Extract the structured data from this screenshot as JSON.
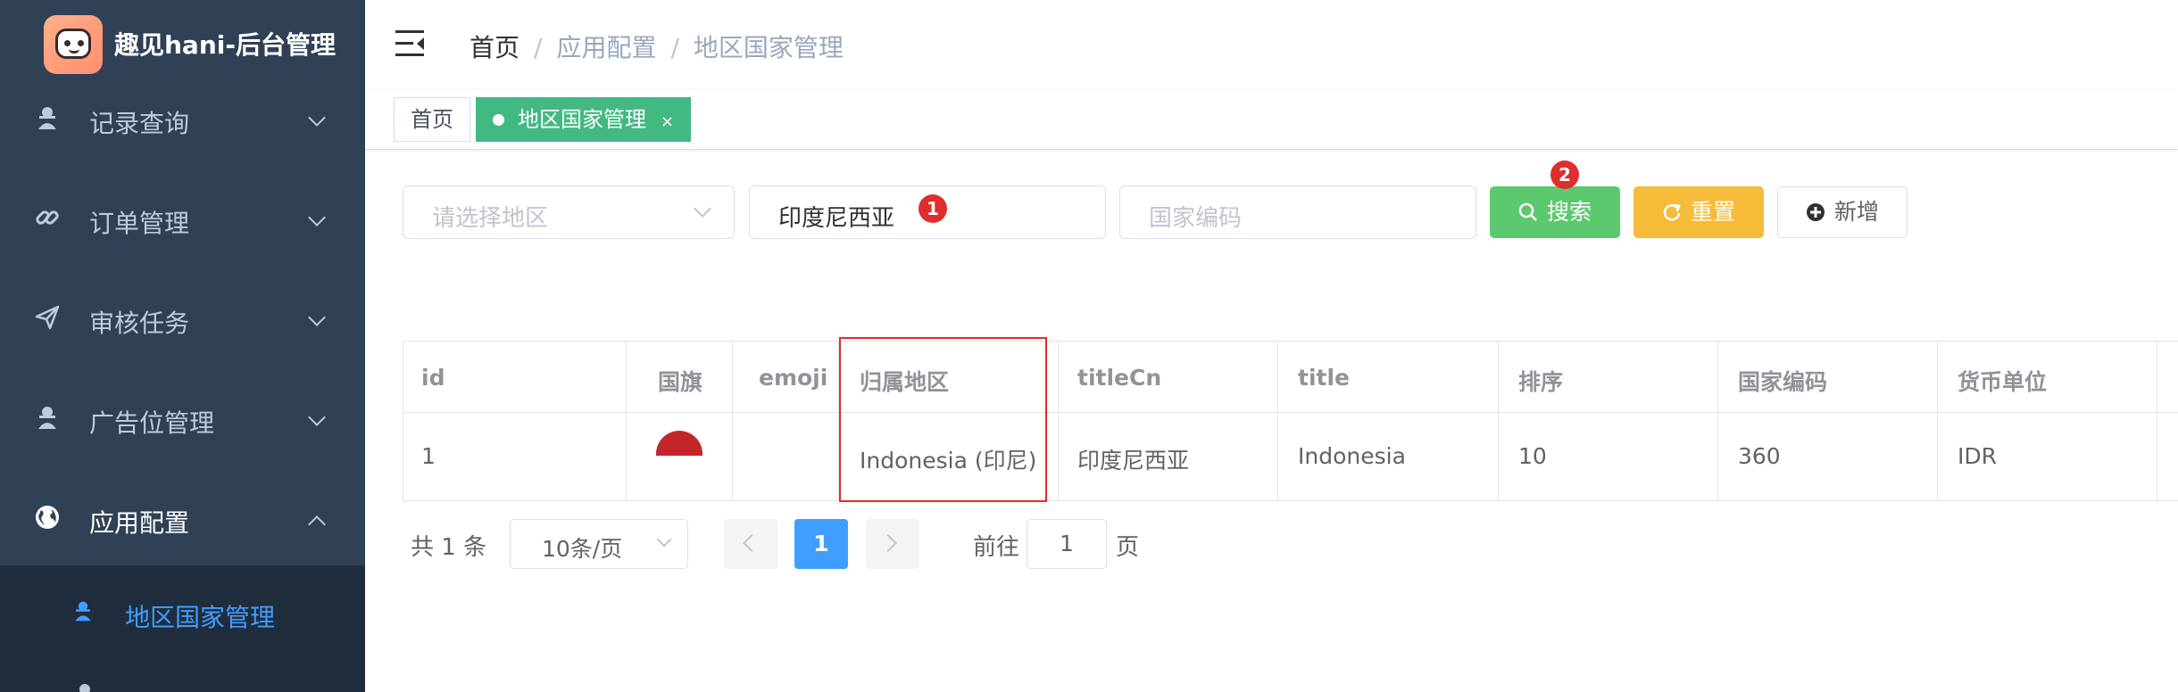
{
  "app": {
    "title": "趣见hani-后台管理"
  },
  "sidebar": {
    "items": [
      {
        "label": "记录查询",
        "icon": "user-spy-icon"
      },
      {
        "label": "订单管理",
        "icon": "link-icon"
      },
      {
        "label": "审核任务",
        "icon": "send-icon"
      },
      {
        "label": "广告位管理",
        "icon": "user-spy-icon"
      },
      {
        "label": "应用配置",
        "icon": "globe-icon"
      }
    ],
    "submenu": {
      "label": "地区国家管理",
      "icon": "user-spy-icon"
    }
  },
  "breadcrumb": [
    "首页",
    "应用配置",
    "地区国家管理"
  ],
  "breadcrumb_sep": "/",
  "tags": [
    {
      "label": "首页"
    },
    {
      "label": "地区国家管理",
      "close": "×"
    }
  ],
  "search": {
    "region_placeholder": "请选择地区",
    "name_value": "印度尼西亚",
    "code_placeholder": "国家编码",
    "search_label": "搜索",
    "reset_label": "重置",
    "add_label": "新增",
    "badge_1": "1",
    "badge_2": "2"
  },
  "table": {
    "headers": [
      "id",
      "国旗",
      "emoji",
      "归属地区",
      "titleCn",
      "title",
      "排序",
      "国家编码",
      "货币单位"
    ],
    "rows": [
      {
        "id": "1",
        "flag": "flag-indonesia",
        "emoji": "",
        "region": "Indonesia (印尼)",
        "titleCn": "印度尼西亚",
        "title": "Indonesia",
        "sort": "10",
        "code": "360",
        "currency": "IDR"
      }
    ]
  },
  "pagination": {
    "total": "共 1 条",
    "page_size": "10条/页",
    "current": "1",
    "goto_label": "前往",
    "goto_value": "1",
    "page_label": "页"
  },
  "colors": {
    "sidebar_bg": "#304156",
    "submenu_bg": "#1f2d3d",
    "active_link": "#409eff",
    "tag_active": "#42b983",
    "search_btn": "#5cc96e",
    "reset_btn": "#f7bb3a",
    "highlight": "#e02d2d"
  }
}
